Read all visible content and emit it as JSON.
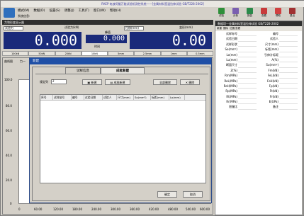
{
  "window": {
    "title": "RAEP·电液伺服万能试验机测控系统——[金属材料室温拉伸试验 GB/T228-2002]"
  },
  "menu": [
    "模式(M)",
    "数据(D)",
    "设置(S)",
    "调整(J)",
    "工具(T)",
    "窗口(W)",
    "帮助(H)"
  ],
  "sysinfo": "系统信息:",
  "toolbar": [
    {
      "label": "试验",
      "color": "#2f8f3a",
      "icon": "test-icon"
    },
    {
      "label": "分析",
      "color": "#7a5fb0",
      "icon": "analysis-icon"
    },
    {
      "label": "报告",
      "color": "#2b8a4a",
      "icon": "report-icon"
    },
    {
      "label": "查看",
      "color": "#c83a3a",
      "icon": "view-icon"
    },
    {
      "label": "帮助",
      "color": "#d04040",
      "icon": "help-icon"
    },
    {
      "label": "退出",
      "color": "#a03030",
      "icon": "exit-icon"
    }
  ],
  "readout": {
    "panel_title": "力和形变显示器",
    "force_mode": "试验力",
    "force_label": "试验力(kN)",
    "force_value": "0.000",
    "peak_label": "峰值",
    "peak_value": "0.000",
    "disp_mode": "位移(mm)",
    "disp_label": "变形(mm)",
    "disp_value": "0.00",
    "time_label": "时间",
    "time_value": "0"
  },
  "ranges": [
    "100kN",
    "50kN",
    "20kN",
    "10kN",
    "5mm",
    "2.5mm",
    "1mm",
    "0.5mm"
  ],
  "right_panel": {
    "title": "数据项—金属材料室温拉伸试验 GB/T228-2002",
    "tools": [
      "新建",
      "删除",
      "位置/查看"
    ],
    "fields": [
      [
        "试样标号",
        "编号"
      ],
      [
        "试验日期",
        "试验人"
      ],
      [
        "试样形状",
        "尺寸(mm)"
      ],
      [
        "So(mm²)",
        "标距(mm)"
      ],
      [
        "Lo(mm)",
        "引伸计标距"
      ],
      [
        "Lu(mm)",
        "A(%)"
      ],
      [
        "断面尺寸",
        "Su(mm²)"
      ],
      [
        "Z(%)",
        "Fm(kN)"
      ],
      [
        "Rm(MPa)",
        "FeL(kN)"
      ],
      [
        "ReL(MPa)",
        "FeH(kN)"
      ],
      [
        "ReH(MPa)",
        "Fp(kN)"
      ],
      [
        "Rp(MPa)",
        "Ft(kN)"
      ],
      [
        "Rt(MPa)",
        "Fr(kN)"
      ],
      [
        "Rr(MPa)",
        "E(GPa)"
      ],
      [
        "屈服比",
        "备注"
      ]
    ]
  },
  "chart": {
    "tab_label": "曲线图",
    "tab2": "力—",
    "y_ticks": [
      "100.0",
      "80.0",
      "60.0",
      "40.0",
      "20.0",
      "0"
    ],
    "x_ticks": [
      "0",
      "60.00",
      "120.00",
      "180.00",
      "240.00",
      "300.00",
      "360.00",
      "420.00",
      "480.00",
      "540.00",
      "600.00"
    ]
  },
  "dialog": {
    "title": "新建",
    "tab_info": "试样信息",
    "tab_batch": "成批新建",
    "spec_label": "规定列",
    "spec_value": "2",
    "btn_new": "新建",
    "btn_batch_new": "成批新建",
    "btn_all_delete": "全部删除",
    "btn_delete": "删除",
    "columns": [
      "序号",
      "试样批号",
      "编号",
      "试验日期",
      "试验人",
      "尺寸(mm)",
      "So(mm²)",
      "标距(mm)",
      "Lo(mm)"
    ],
    "ok": "确定",
    "cancel": "取消"
  }
}
